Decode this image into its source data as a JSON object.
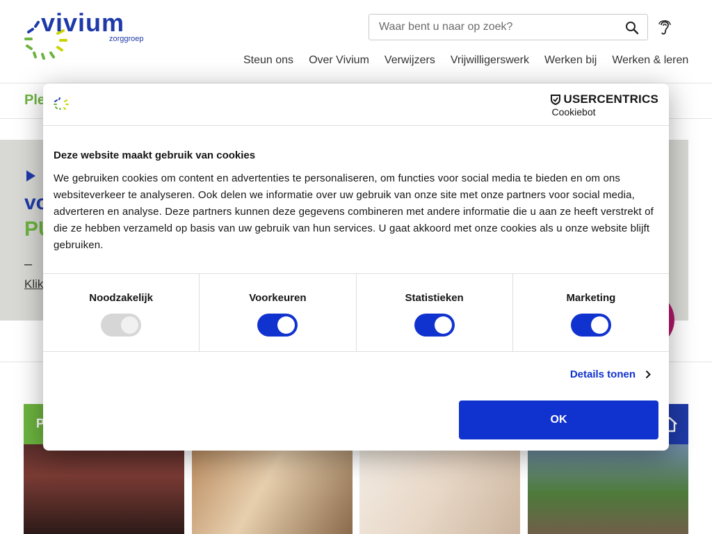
{
  "brand": {
    "name": "vivium",
    "subtitle": "zorggroep",
    "blue": "#1e3aa8",
    "green": "#6cb33f"
  },
  "search": {
    "placeholder": "Waar bent u naar op zoek?",
    "icon": "search-icon"
  },
  "header": {
    "accessibility_icon": "ear-icon"
  },
  "nav": {
    "items": [
      "Steun ons",
      "Over Vivium",
      "Verwijzers",
      "Vrijwilligerswerk",
      "Werken bij",
      "Werken & leren"
    ]
  },
  "background_page": {
    "subbar_text": "Ple",
    "hero": {
      "line1": "vo",
      "line2": "PU",
      "dash": "–",
      "link": "Klik"
    },
    "card1_band_text": "P"
  },
  "cookie_dialog": {
    "provider_brand": "USERCENTRICS",
    "provider_product": "Cookiebot",
    "title": "Deze website maakt gebruik van cookies",
    "text": "We gebruiken cookies om content en advertenties te personaliseren, om functies voor social media te bieden en om ons websiteverkeer te analyseren. Ook delen we informatie over uw gebruik van onze site met onze partners voor social media, adverteren en analyse. Deze partners kunnen deze gegevens combineren met andere informatie die u aan ze heeft verstrekt of die ze hebben verzameld op basis van uw gebruik van hun services. U gaat akkoord met onze cookies als u onze website blijft gebruiken.",
    "categories": [
      {
        "label": "Noodzakelijk",
        "enabled": true,
        "locked": true
      },
      {
        "label": "Voorkeuren",
        "enabled": true,
        "locked": false
      },
      {
        "label": "Statistieken",
        "enabled": true,
        "locked": false
      },
      {
        "label": "Marketing",
        "enabled": true,
        "locked": false
      }
    ],
    "details_label": "Details tonen",
    "ok_label": "OK",
    "accent": "#1032cf"
  }
}
